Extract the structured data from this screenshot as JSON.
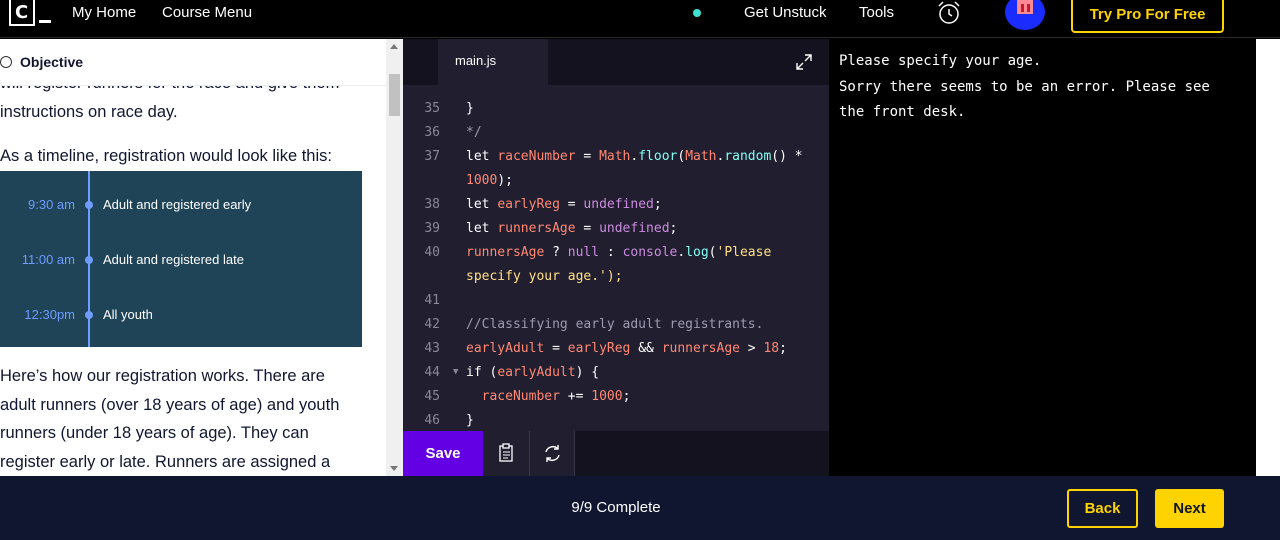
{
  "nav": {
    "home": "My Home",
    "course_menu": "Course Menu",
    "get_unstuck": "Get Unstuck",
    "tools": "Tools",
    "try_pro": "Try Pro For Free"
  },
  "lesson": {
    "header": "Objective",
    "para_cut": "will register runners for the race and give them instructions on race day.",
    "timeline_intro": "As a timeline, registration would look like this:",
    "timeline": [
      {
        "time": "9:30 am",
        "label": "Adult and registered early"
      },
      {
        "time": "11:00 am",
        "label": "Adult and registered late"
      },
      {
        "time": "12:30pm",
        "label": "All youth"
      }
    ],
    "para_after": "Here’s how our registration works. There are adult runners (over 18 years of age) and youth runners (under 18 years of age). They can register early or late. Runners are assigned a"
  },
  "editor": {
    "tab": "main.js",
    "save_label": "Save",
    "lines": [
      {
        "n": "35",
        "text": "}"
      },
      {
        "n": "36",
        "text": "*/"
      },
      {
        "n": "37",
        "text": "let raceNumber = Math.floor(Math.random() *"
      },
      {
        "n": "",
        "text": "1000);"
      },
      {
        "n": "38",
        "text": "let earlyReg = undefined;"
      },
      {
        "n": "39",
        "text": "let runnersAge = undefined;"
      },
      {
        "n": "40",
        "text": "runnersAge ? null : console.log('Please"
      },
      {
        "n": "",
        "text": "specify your age.');"
      },
      {
        "n": "41",
        "text": ""
      },
      {
        "n": "42",
        "text": "//Classifying early adult registrants."
      },
      {
        "n": "43",
        "text": "earlyAdult = earlyReg && runnersAge > 18;"
      },
      {
        "n": "44",
        "text": "if (earlyAdult) {"
      },
      {
        "n": "45",
        "text": "  raceNumber += 1000;"
      },
      {
        "n": "46",
        "text": "}"
      }
    ]
  },
  "output": {
    "text": "Please specify your age.\nSorry there seems to be an error. Please see\nthe front desk."
  },
  "footer": {
    "progress": "9/9 Complete",
    "back": "Back",
    "next": "Next"
  },
  "icons": {
    "logo": "codecademy-logo",
    "alarm": "alarm-clock-icon",
    "expand": "expand-icon",
    "clipboard": "clipboard-icon",
    "refresh": "refresh-icon",
    "objective": "target-icon"
  },
  "colors": {
    "accent_yellow": "#ffd300",
    "save_purple": "#6400e4",
    "timeline_bg": "#1f4357",
    "editor_bg": "#211e2f"
  }
}
